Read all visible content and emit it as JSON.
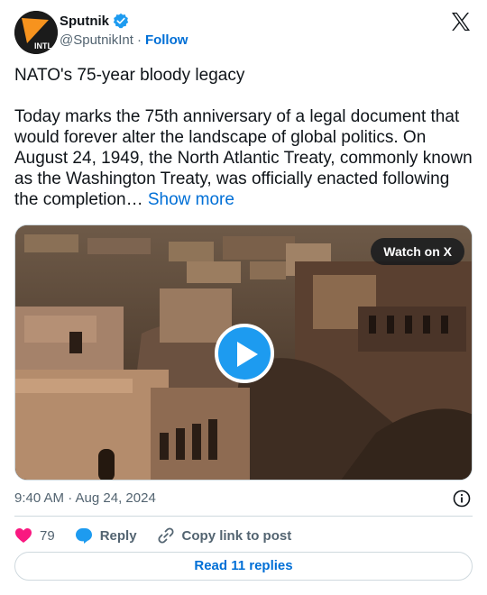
{
  "author": {
    "display_name": "Sputnik",
    "handle": "@SputnikInt",
    "separator": "·",
    "follow_label": "Follow",
    "avatar_text": "INTL"
  },
  "tweet": {
    "title": "NATO's 75-year bloody legacy",
    "text": "Today marks the 75th anniversary of a legal document that would forever alter the landscape of global politics. On August 24, 1949, the North Atlantic Treaty, commonly known as the Washington Treaty, was officially enacted following the completion…",
    "show_more": "Show more"
  },
  "media": {
    "watch_label": "Watch on X"
  },
  "meta": {
    "timestamp": "9:40 AM · Aug 24, 2024"
  },
  "actions": {
    "like_count": "79",
    "reply_label": "Reply",
    "copy_label": "Copy link to post"
  },
  "footer": {
    "read_replies": "Read 11 replies"
  },
  "colors": {
    "accent": "#1d9bf0",
    "link": "#006fd6",
    "like": "#f91880",
    "muted": "#536471"
  }
}
